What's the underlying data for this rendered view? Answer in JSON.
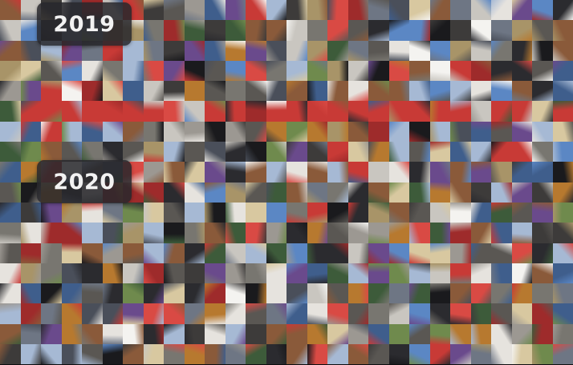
{
  "years": {
    "first": "2019",
    "second": "2020"
  },
  "palette": {
    "background": "#0d0d0f",
    "badge_background": "#28282c",
    "badge_text": "#f2f2f2",
    "tile_tones": [
      "#2b2b2f",
      "#3d3b3a",
      "#5a5753",
      "#787670",
      "#9c9892",
      "#c9c6c0",
      "#e6e3de",
      "#f4f3f0",
      "#1a1a1d",
      "#4a4f5a",
      "#6e7684",
      "#8a5a3a",
      "#b7792f",
      "#c83a36",
      "#d94a44",
      "#9e2b2b",
      "#3f5e8c",
      "#5b87c4",
      "#a6b9d4",
      "#3d5b3a",
      "#6f8a4d",
      "#a89468",
      "#d8c8a0",
      "#6a4a8c"
    ],
    "red_tone": "#c83a36"
  }
}
